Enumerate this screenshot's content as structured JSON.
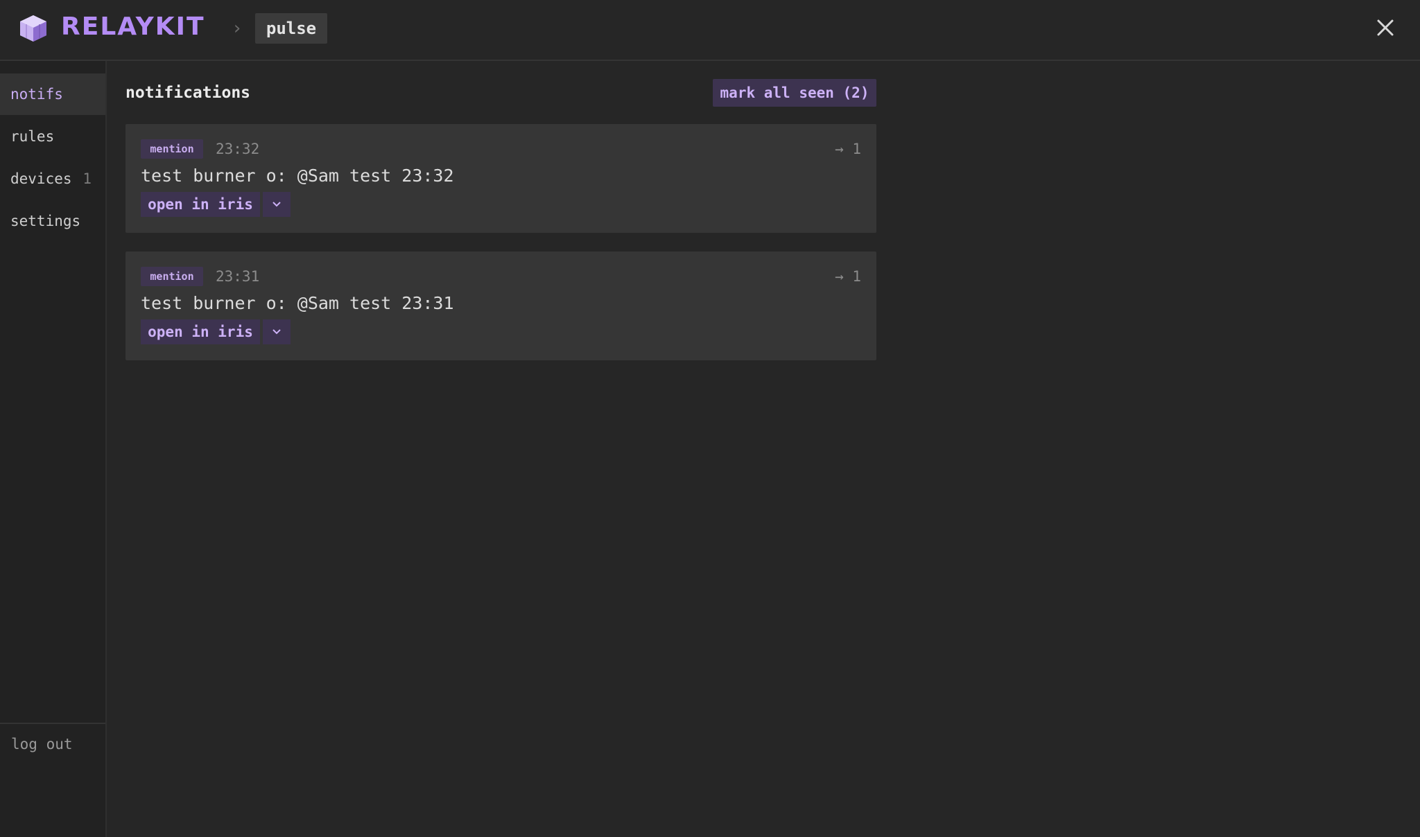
{
  "header": {
    "brand": "RELAYKIT",
    "breadcrumb_sep": "›",
    "breadcrumb_current": "pulse",
    "icons": {
      "logo": "cube-logo-icon",
      "close": "close-icon"
    }
  },
  "sidebar": {
    "items": [
      {
        "label": "notifs",
        "count": "",
        "active": true
      },
      {
        "label": "rules",
        "count": ""
      },
      {
        "label": "devices",
        "count": "1"
      },
      {
        "label": "settings",
        "count": ""
      }
    ],
    "logout": "log out"
  },
  "main": {
    "title": "notifications",
    "mark_all": "mark all seen (2)",
    "notifications": [
      {
        "type": "mention",
        "time": "23:32",
        "route": "→ 1",
        "message": "test burner o: @Sam test 23:32",
        "action": "open in iris"
      },
      {
        "type": "mention",
        "time": "23:31",
        "route": "→ 1",
        "message": "test burner o: @Sam test 23:31",
        "action": "open in iris"
      }
    ]
  },
  "colors": {
    "accent": "#b48cf5",
    "accent_bg": "#3d3350",
    "background": "#262626",
    "card": "#363636"
  }
}
